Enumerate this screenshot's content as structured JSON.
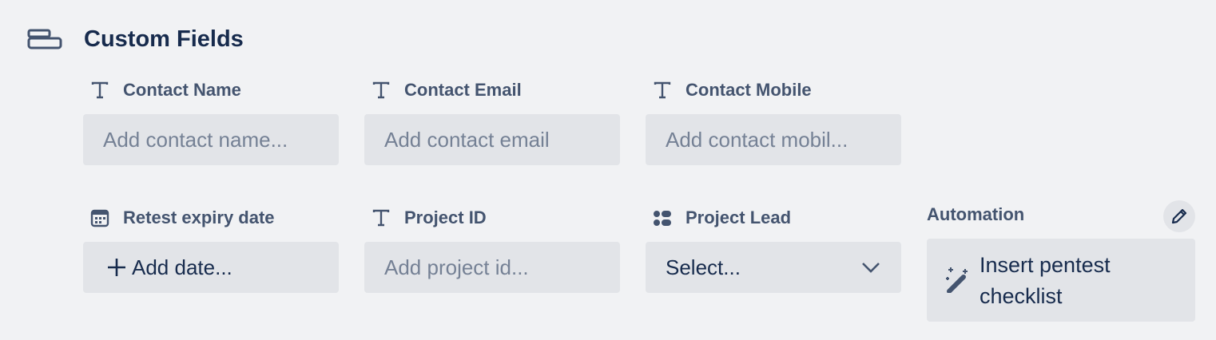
{
  "section": {
    "title": "Custom Fields",
    "icon": "card-fields-icon"
  },
  "fields": [
    {
      "label": "Contact Name",
      "icon": "text-field-icon",
      "placeholder": "Add contact name..."
    },
    {
      "label": "Contact Email",
      "icon": "text-field-icon",
      "placeholder": "Add contact email"
    },
    {
      "label": "Contact Mobile",
      "icon": "text-field-icon",
      "placeholder": "Add contact mobil..."
    },
    {
      "label": "Retest expiry date",
      "icon": "calendar-icon",
      "value": "Add date..."
    },
    {
      "label": "Project ID",
      "icon": "text-field-icon",
      "placeholder": "Add project id..."
    },
    {
      "label": "Project Lead",
      "icon": "dropdown-field-icon",
      "value": "Select..."
    }
  ],
  "automation": {
    "title": "Automation",
    "button_label": "Insert pentest checklist",
    "edit_icon": "pencil-icon",
    "button_icon": "magic-wand-icon"
  },
  "colors": {
    "background": "#f1f2f4",
    "field_background": "#e2e4e8",
    "text_primary": "#172b4d",
    "text_label": "#44546f",
    "placeholder": "#758195"
  }
}
